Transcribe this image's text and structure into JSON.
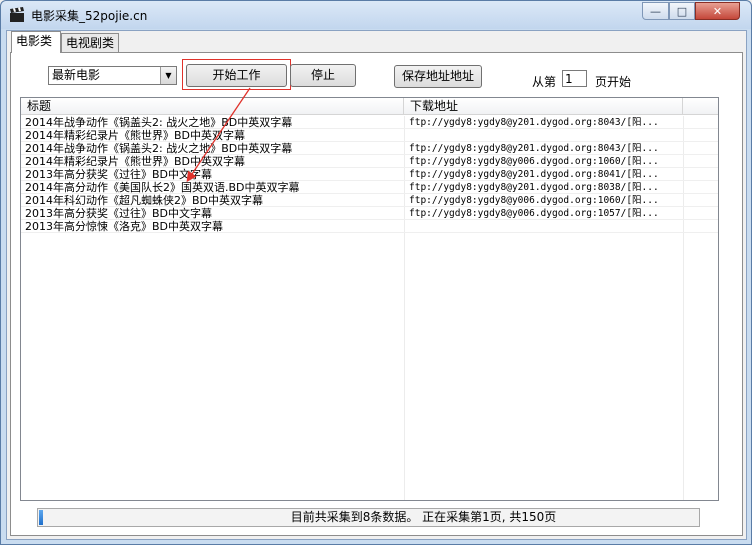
{
  "window": {
    "title": "电影采集_52pojie.cn",
    "min_glyph": "—",
    "max_glyph": "□",
    "close_glyph": "✕"
  },
  "tabs": [
    {
      "label": "电影类",
      "active": true
    },
    {
      "label": "电视剧类",
      "active": false
    }
  ],
  "controls": {
    "category_selected": "最新电影",
    "combo_arrow": "▼",
    "start_label": "开始工作",
    "stop_label": "停止",
    "save_label": "保存地址地址",
    "from_label": "从第",
    "page_value": "1",
    "page_start_label": "页开始"
  },
  "list": {
    "columns": [
      "标题",
      "下载地址"
    ],
    "rows": [
      {
        "title": "2014年战争动作《锅盖头2: 战火之地》BD中英双字幕",
        "url": "ftp://ygdy8:ygdy8@y201.dygod.org:8043/[阳..."
      },
      {
        "title": "2014年精彩纪录片《熊世界》BD中英双字幕",
        "url": ""
      },
      {
        "title": "2014年战争动作《锅盖头2: 战火之地》BD中英双字幕",
        "url": "ftp://ygdy8:ygdy8@y201.dygod.org:8043/[阳..."
      },
      {
        "title": "2014年精彩纪录片《熊世界》BD中英双字幕",
        "url": "ftp://ygdy8:ygdy8@y006.dygod.org:1060/[阳..."
      },
      {
        "title": "2013年高分获奖《过往》BD中文字幕",
        "url": "ftp://ygdy8:ygdy8@y201.dygod.org:8041/[阳..."
      },
      {
        "title": "2014年高分动作《美国队长2》国英双语.BD中英双字幕",
        "url": "ftp://ygdy8:ygdy8@y201.dygod.org:8038/[阳..."
      },
      {
        "title": "2014年科幻动作《超凡蜘蛛侠2》BD中英双字幕",
        "url": "ftp://ygdy8:ygdy8@y006.dygod.org:1060/[阳..."
      },
      {
        "title": "2013年高分获奖《过往》BD中文字幕",
        "url": "ftp://ygdy8:ygdy8@y006.dygod.org:1057/[阳..."
      },
      {
        "title": "2013年高分惊悚《洛克》BD中英双字幕",
        "url": ""
      }
    ]
  },
  "status": {
    "text": "目前共采集到8条数据。 正在采集第1页, 共150页",
    "progress_fraction": 0.006
  },
  "colors": {
    "highlight": "#e0322b",
    "progress": "#1f6fcb"
  }
}
